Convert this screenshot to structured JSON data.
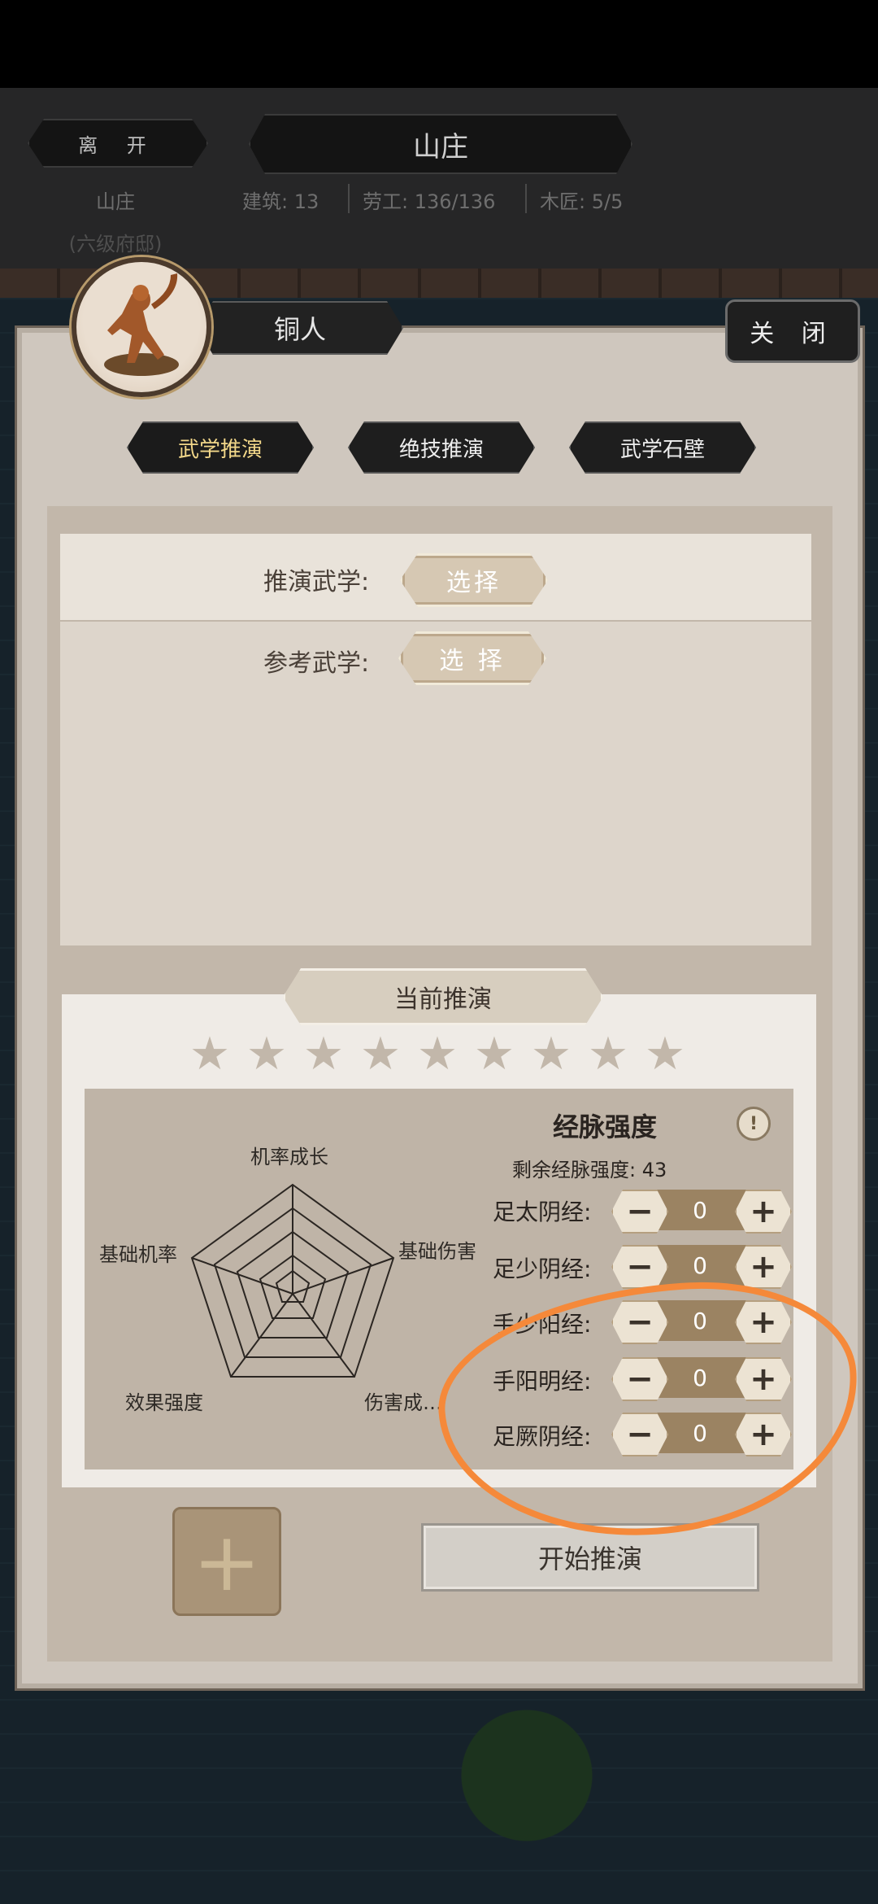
{
  "header": {
    "leave_label": "离 开",
    "title": "山庄",
    "location_name": "山庄",
    "location_rank": "(六级府邸)",
    "stats": {
      "buildings": "建筑: 13",
      "labor": "劳工: 136/136",
      "carpenters": "木匠: 5/5"
    }
  },
  "panel": {
    "character_name": "铜人",
    "close_label": "关 闭",
    "tabs": [
      {
        "label": "武学推演",
        "active": true
      },
      {
        "label": "绝技推演",
        "active": false
      },
      {
        "label": "武学石壁",
        "active": false
      }
    ],
    "select_rows": [
      {
        "label": "推演武学:",
        "button": "选择"
      },
      {
        "label": "参考武学:",
        "button": "选 择"
      }
    ],
    "current_title": "当前推演",
    "stars": [
      "star",
      "star",
      "star",
      "star",
      "star",
      "star",
      "star",
      "star",
      "star"
    ],
    "radar_labels": {
      "top": "机率成长",
      "right": "基础伤害",
      "bottom_right": "伤害成…",
      "bottom_left": "效果强度",
      "left": "基础机率"
    },
    "meridian": {
      "title": "经脉强度",
      "info_icon": "!",
      "remaining": "剩余经脉强度: 43",
      "rows": [
        {
          "label": "足太阴经:",
          "value": "0",
          "minus": "−",
          "plus": "+"
        },
        {
          "label": "足少阴经:",
          "value": "0",
          "minus": "−",
          "plus": "+"
        },
        {
          "label": "手少阳经:",
          "value": "0",
          "minus": "−",
          "plus": "+"
        },
        {
          "label": "手阳明经:",
          "value": "0",
          "minus": "−",
          "plus": "+"
        },
        {
          "label": "足厥阴经:",
          "value": "0",
          "minus": "−",
          "plus": "+"
        }
      ]
    },
    "add_slot_icon": "+",
    "start_label": "开始推演"
  },
  "colors": {
    "annotation": "#f5893a",
    "active_tab_text": "#f2d789"
  }
}
